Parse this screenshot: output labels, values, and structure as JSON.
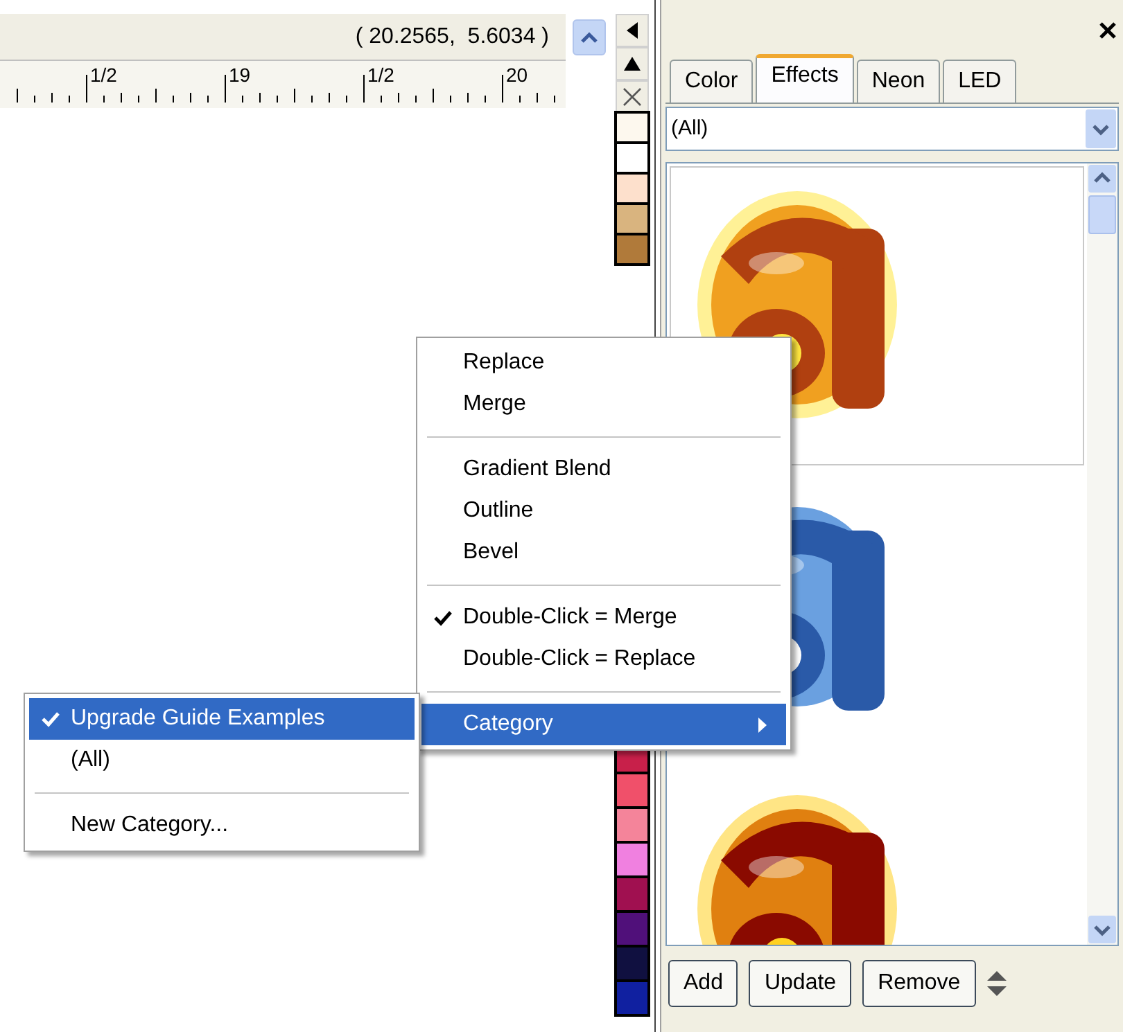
{
  "coordinates": "( 20.2565,  5.6034 )",
  "ruler": {
    "labels": [
      "1/2",
      "19",
      "1/2",
      "20"
    ]
  },
  "palette": {
    "top": [
      {
        "color": "#fdf8ee"
      },
      {
        "color": "#ffffff"
      },
      {
        "color": "#fde0cc"
      },
      {
        "color": "#d9b47f"
      },
      {
        "color": "#b07a3a"
      }
    ],
    "bottom": [
      {
        "color": "#c8204a"
      },
      {
        "color": "#f0506a"
      },
      {
        "color": "#f4849a"
      },
      {
        "color": "#f080e0"
      },
      {
        "color": "#a01050"
      },
      {
        "color": "#50107a"
      },
      {
        "color": "#101040"
      },
      {
        "color": "#1020a0"
      }
    ]
  },
  "panel": {
    "tabs": [
      {
        "label": "Color",
        "selected": false
      },
      {
        "label": "Effects",
        "selected": true
      },
      {
        "label": "Neon",
        "selected": false
      },
      {
        "label": "LED",
        "selected": false
      }
    ],
    "category_dropdown": {
      "value": "(All)"
    },
    "thumbnails": [
      {
        "kind": "picture",
        "selected": true
      },
      {
        "kind": "picture",
        "selected": false
      },
      {
        "kind": "picture",
        "selected": false
      }
    ],
    "buttons": [
      "Add",
      "Update",
      "Remove"
    ]
  },
  "context_menu": [
    {
      "kind": "item",
      "label": "Replace",
      "checked": false,
      "selected": false
    },
    {
      "kind": "item",
      "label": "Merge",
      "checked": false,
      "selected": false
    },
    {
      "kind": "separator"
    },
    {
      "kind": "item",
      "label": "Gradient Blend",
      "checked": false,
      "selected": false
    },
    {
      "kind": "item",
      "label": "Outline",
      "checked": false,
      "selected": false
    },
    {
      "kind": "item",
      "label": "Bevel",
      "checked": false,
      "selected": false
    },
    {
      "kind": "separator"
    },
    {
      "kind": "item",
      "label": "Double-Click = Merge",
      "checked": true,
      "selected": false
    },
    {
      "kind": "item",
      "label": "Double-Click = Replace",
      "checked": false,
      "selected": false
    },
    {
      "kind": "separator"
    },
    {
      "kind": "submenu",
      "label": "Category",
      "checked": false,
      "selected": true
    }
  ],
  "submenu": [
    {
      "kind": "item",
      "label": "Upgrade Guide Examples",
      "checked": true,
      "selected": true
    },
    {
      "kind": "item",
      "label": "(All)",
      "checked": false,
      "selected": false
    },
    {
      "kind": "separator"
    },
    {
      "kind": "item",
      "label": "New Category...",
      "checked": false,
      "selected": false
    }
  ]
}
